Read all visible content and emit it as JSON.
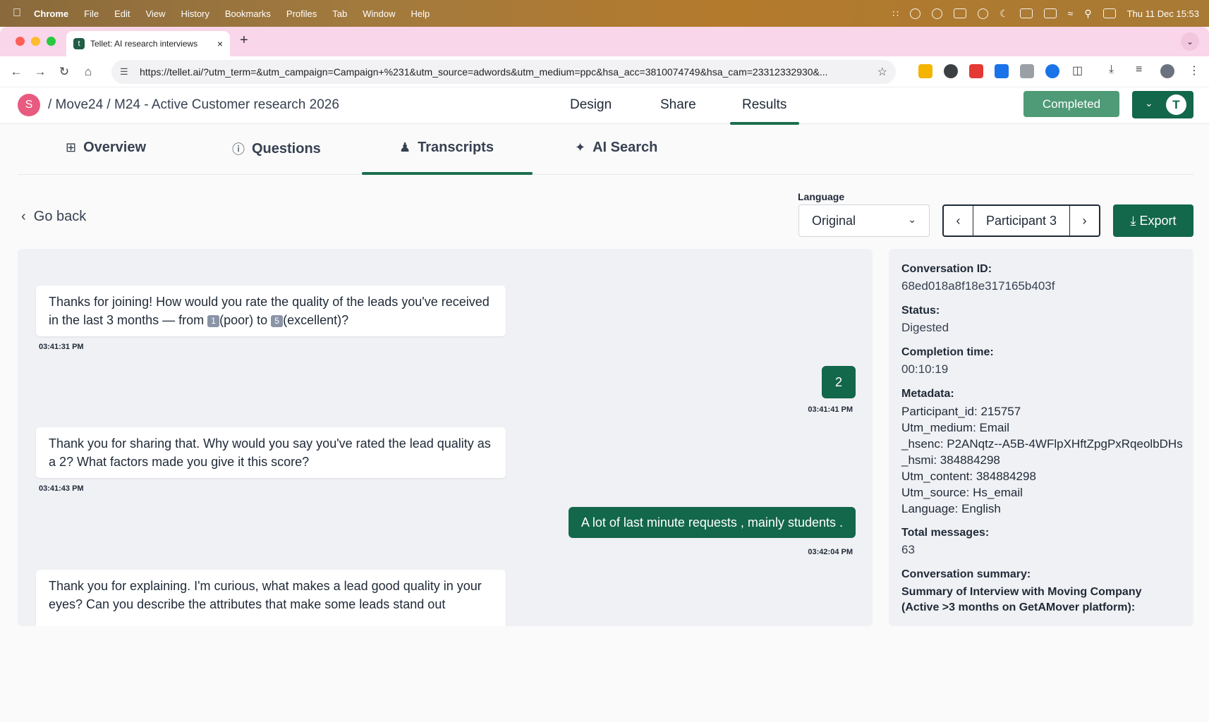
{
  "menubar": {
    "app": "Chrome",
    "items": [
      "File",
      "Edit",
      "View",
      "History",
      "Bookmarks",
      "Profiles",
      "Tab",
      "Window",
      "Help"
    ],
    "clock": "Thu 11 Dec  15:53"
  },
  "browser": {
    "tab_title": "Tellet: AI research interviews",
    "url": "https://tellet.ai/?utm_term=&utm_campaign=Campaign+%231&utm_source=adwords&utm_medium=ppc&hsa_acc=3810074749&hsa_cam=23312332930&..."
  },
  "header": {
    "avatar_letter": "S",
    "breadcrumb": "/ Move24 / M24 - Active Customer research 2026",
    "nav": [
      "Design",
      "Share",
      "Results"
    ],
    "status_button": "Completed",
    "user_initial": "T"
  },
  "subtabs": [
    "Overview",
    "Questions",
    "Transcripts",
    "AI Search"
  ],
  "controls": {
    "go_back": "Go back",
    "language_label": "Language",
    "language_value": "Original",
    "participant": "Participant  3",
    "export": "Export"
  },
  "messages": [
    {
      "role": "assistant",
      "text_before": "Thanks for joining! How would you rate the quality of the leads you've received in the last 3 months — from ",
      "key1": "1",
      "mid": "(poor) to ",
      "key2": "5",
      "after": "(excellent)?",
      "time": "03:41:31 PM"
    },
    {
      "role": "user",
      "text": "2",
      "time": "03:41:41 PM"
    },
    {
      "role": "assistant",
      "text": "Thank you for sharing that. Why would you say you've rated the lead quality as a 2? What factors made you give it this score?",
      "time": "03:41:43 PM"
    },
    {
      "role": "user",
      "text": "A lot of last minute requests , mainly students .",
      "time": "03:42:04 PM"
    },
    {
      "role": "assistant",
      "text": "Thank you for explaining. I'm curious, what makes a lead good quality in your eyes? Can you describe the attributes that make some leads stand out"
    }
  ],
  "info": {
    "conversation_id_label": "Conversation ID:",
    "conversation_id": "68ed018a8f18e317165b403f",
    "status_label": "Status:",
    "status": "Digested",
    "completion_label": "Completion time:",
    "completion": "00:10:19",
    "metadata_label": "Metadata:",
    "metadata": [
      "Participant_id: 215757",
      "Utm_medium: Email",
      "_hsenc: P2ANqtz--A5B-4WFlpXHftZpgPxRqeolbDHs",
      "_hsmi: 384884298",
      "Utm_content: 384884298",
      "Utm_source: Hs_email",
      "Language: English"
    ],
    "total_messages_label": "Total messages:",
    "total_messages": "63",
    "summary_label": "Conversation summary:",
    "summary": "Summary of Interview with Moving Company (Active >3 months on GetAMover platform):"
  },
  "colors": {
    "brand_green": "#13674a",
    "completed_green": "#4f9a77",
    "avatar_pink": "#e85a7f",
    "tabstrip_pink": "#f9d6ea"
  }
}
